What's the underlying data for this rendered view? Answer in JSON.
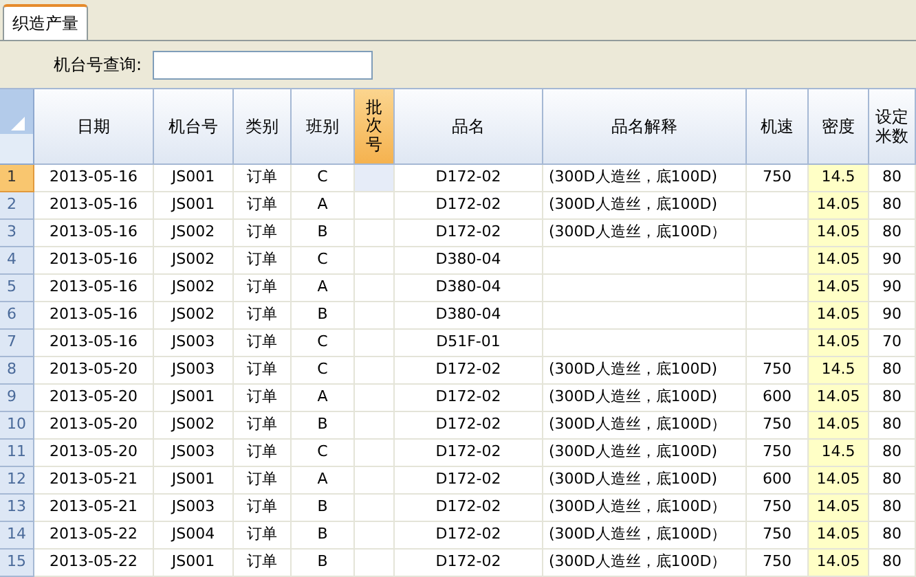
{
  "tabs": [
    {
      "label": "织造产量",
      "selected": true
    }
  ],
  "search": {
    "label": "机台号查询:"
  },
  "table": {
    "columns": [
      {
        "label": "日期",
        "selected": false,
        "highlighted": false
      },
      {
        "label": "机台号",
        "selected": false,
        "highlighted": false
      },
      {
        "label": "类别",
        "selected": false,
        "highlighted": false
      },
      {
        "label": "班别",
        "selected": false,
        "highlighted": false
      },
      {
        "label": "批次号",
        "selected": true,
        "highlighted": false
      },
      {
        "label": "品名",
        "selected": false,
        "highlighted": false
      },
      {
        "label": "品名解释",
        "selected": false,
        "highlighted": false
      },
      {
        "label": "机速",
        "selected": false,
        "highlighted": false
      },
      {
        "label": "密度",
        "selected": false,
        "highlighted": true
      },
      {
        "label": "设定米数",
        "selected": false,
        "highlighted": false
      }
    ],
    "rows": [
      {
        "number": "1",
        "selected": true,
        "cells": [
          "2013-05-16",
          "JS001",
          "订单",
          "C",
          "",
          "D172-02",
          "(300D人造丝，底100D)",
          "750",
          "14.5",
          "80"
        ]
      },
      {
        "number": "2",
        "selected": false,
        "cells": [
          "2013-05-16",
          "JS001",
          "订单",
          "A",
          "",
          "D172-02",
          "(300D人造丝，底100D)",
          "",
          "14.05",
          "80"
        ]
      },
      {
        "number": "3",
        "selected": false,
        "cells": [
          "2013-05-16",
          "JS002",
          "订单",
          "B",
          "",
          "D172-02",
          "(300D人造丝，底100D）",
          "",
          "14.05",
          "80"
        ]
      },
      {
        "number": "4",
        "selected": false,
        "cells": [
          "2013-05-16",
          "JS002",
          "订单",
          "C",
          "",
          "D380-04",
          "",
          "",
          "14.05",
          "90"
        ]
      },
      {
        "number": "5",
        "selected": false,
        "cells": [
          "2013-05-16",
          "JS002",
          "订单",
          "A",
          "",
          "D380-04",
          "",
          "",
          "14.05",
          "90"
        ]
      },
      {
        "number": "6",
        "selected": false,
        "cells": [
          "2013-05-16",
          "JS002",
          "订单",
          "B",
          "",
          "D380-04",
          "",
          "",
          "14.05",
          "90"
        ]
      },
      {
        "number": "7",
        "selected": false,
        "cells": [
          "2013-05-16",
          "JS003",
          "订单",
          "C",
          "",
          "D51F-01",
          "",
          "",
          "14.05",
          "70"
        ]
      },
      {
        "number": "8",
        "selected": false,
        "cells": [
          "2013-05-20",
          "JS003",
          "订单",
          "C",
          "",
          "D172-02",
          "(300D人造丝，底100D)",
          "750",
          "14.5",
          "80"
        ]
      },
      {
        "number": "9",
        "selected": false,
        "cells": [
          "2013-05-20",
          "JS001",
          "订单",
          "A",
          "",
          "D172-02",
          "(300D人造丝，底100D)",
          "600",
          "14.05",
          "80"
        ]
      },
      {
        "number": "10",
        "selected": false,
        "cells": [
          "2013-05-20",
          "JS002",
          "订单",
          "B",
          "",
          "D172-02",
          "(300D人造丝，底100D）",
          "750",
          "14.05",
          "80"
        ]
      },
      {
        "number": "11",
        "selected": false,
        "cells": [
          "2013-05-20",
          "JS003",
          "订单",
          "C",
          "",
          "D172-02",
          "(300D人造丝，底100D)",
          "750",
          "14.5",
          "80"
        ]
      },
      {
        "number": "12",
        "selected": false,
        "cells": [
          "2013-05-21",
          "JS001",
          "订单",
          "A",
          "",
          "D172-02",
          "(300D人造丝，底100D)",
          "600",
          "14.05",
          "80"
        ]
      },
      {
        "number": "13",
        "selected": false,
        "cells": [
          "2013-05-21",
          "JS003",
          "订单",
          "B",
          "",
          "D172-02",
          "(300D人造丝，底100D）",
          "750",
          "14.05",
          "80"
        ]
      },
      {
        "number": "14",
        "selected": false,
        "cells": [
          "2013-05-22",
          "JS004",
          "订单",
          "B",
          "",
          "D172-02",
          "(300D人造丝，底100D）",
          "750",
          "14.05",
          "80"
        ]
      },
      {
        "number": "15",
        "selected": false,
        "cells": [
          "2013-05-22",
          "JS001",
          "订单",
          "B",
          "",
          "D172-02",
          "(300D人造丝，底100D）",
          "750",
          "14.05",
          "80"
        ]
      }
    ]
  }
}
